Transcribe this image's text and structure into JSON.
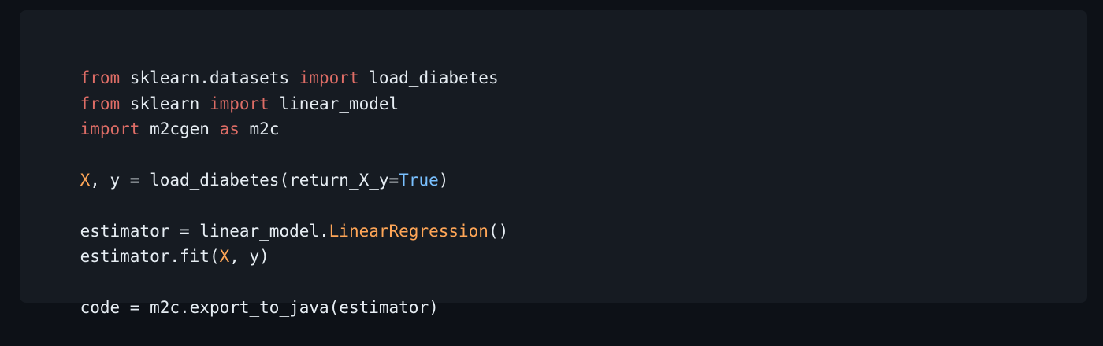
{
  "code": {
    "line1": [
      {
        "kind": "keyword",
        "text": "from"
      },
      {
        "kind": "plain",
        "text": " sklearn.datasets "
      },
      {
        "kind": "keyword",
        "text": "import"
      },
      {
        "kind": "plain",
        "text": " load_diabetes"
      }
    ],
    "line2": [
      {
        "kind": "keyword",
        "text": "from"
      },
      {
        "kind": "plain",
        "text": " sklearn "
      },
      {
        "kind": "keyword",
        "text": "import"
      },
      {
        "kind": "plain",
        "text": " linear_model"
      }
    ],
    "line3": [
      {
        "kind": "keyword",
        "text": "import"
      },
      {
        "kind": "plain",
        "text": " m2cgen "
      },
      {
        "kind": "keyword",
        "text": "as"
      },
      {
        "kind": "plain",
        "text": " m2c"
      }
    ],
    "line5": [
      {
        "kind": "var",
        "text": "X"
      },
      {
        "kind": "plain",
        "text": ", y = load_diabetes(return_X_y="
      },
      {
        "kind": "const",
        "text": "True"
      },
      {
        "kind": "plain",
        "text": ")"
      }
    ],
    "line7": [
      {
        "kind": "plain",
        "text": "estimator = linear_model."
      },
      {
        "kind": "var",
        "text": "LinearRegression"
      },
      {
        "kind": "plain",
        "text": "()"
      }
    ],
    "line8": [
      {
        "kind": "plain",
        "text": "estimator.fit("
      },
      {
        "kind": "var",
        "text": "X"
      },
      {
        "kind": "plain",
        "text": ", y)"
      }
    ],
    "line10": [
      {
        "kind": "plain",
        "text": "code = m2c.export_to_java(estimator)"
      }
    ]
  },
  "colors": {
    "page_background": "#0d1117",
    "block_background": "#161b22",
    "keyword": "#ff7b72",
    "identifier_highlight": "#ffa657",
    "constant": "#79c0ff",
    "text": "#e6edf3"
  }
}
